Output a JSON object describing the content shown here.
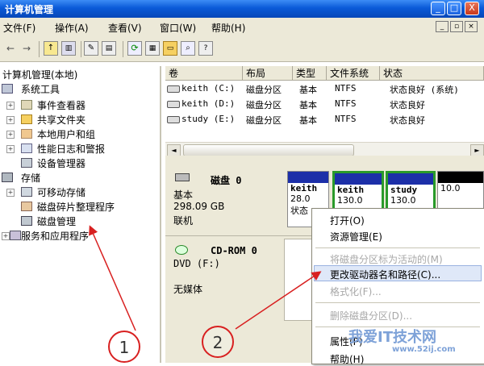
{
  "window": {
    "title": "计算机管理",
    "min": "_",
    "max": "□",
    "close": "X"
  },
  "menu": {
    "file": "文件(F)",
    "action": "操作(A)",
    "view": "查看(V)",
    "window": "窗口(W)",
    "help": "帮助(H)"
  },
  "tree": {
    "root": "计算机管理(本地)",
    "system_tools": "系统工具",
    "event_viewer": "事件查看器",
    "shared_folders": "共享文件夹",
    "local_users": "本地用户和组",
    "perf_logs": "性能日志和警报",
    "device_manager": "设备管理器",
    "storage": "存储",
    "removable": "可移动存储",
    "defrag": "磁盘碎片整理程序",
    "disk_mgmt": "磁盘管理",
    "services": "服务和应用程序"
  },
  "list": {
    "headers": [
      "卷",
      "布局",
      "类型",
      "文件系统",
      "状态"
    ],
    "rows": [
      [
        "keith (C:)",
        "磁盘分区",
        "基本",
        "NTFS",
        "状态良好 (系统)"
      ],
      [
        "keith (D:)",
        "磁盘分区",
        "基本",
        "NTFS",
        "状态良好"
      ],
      [
        "study (E:)",
        "磁盘分区",
        "基本",
        "NTFS",
        "状态良好"
      ]
    ]
  },
  "disk0": {
    "name": "磁盘 0",
    "type": "基本",
    "size": "298.09 GB",
    "status": "联机"
  },
  "partitions": [
    {
      "label": "keith",
      "size": "28.0",
      "status": "状态"
    },
    {
      "label": "keith",
      "size": "130.0",
      "status": ""
    },
    {
      "label": "study",
      "size": "130.0",
      "status": ""
    },
    {
      "label": "",
      "size": "10.0",
      "status": ""
    }
  ],
  "cdrom": {
    "name": "CD-ROM 0",
    "drive": "DVD (F:)",
    "media": "无媒体"
  },
  "context_menu": {
    "open": "打开(O)",
    "explore": "资源管理(E)",
    "mark_active": "将磁盘分区标为活动的(M)",
    "change_letter": "更改驱动器名和路径(C)...",
    "format": "格式化(F)...",
    "delete": "删除磁盘分区(D)...",
    "properties": "属性(P)",
    "help": "帮助(H)"
  },
  "annotations": {
    "one": "1",
    "two": "2"
  },
  "watermark": {
    "brand": "我爱IT技术网",
    "url": "www.52ij.com"
  },
  "colors": {
    "title_bar": "#0a5ad8",
    "partition_bar": "#1c2fa8",
    "arrow": "#d82020"
  }
}
